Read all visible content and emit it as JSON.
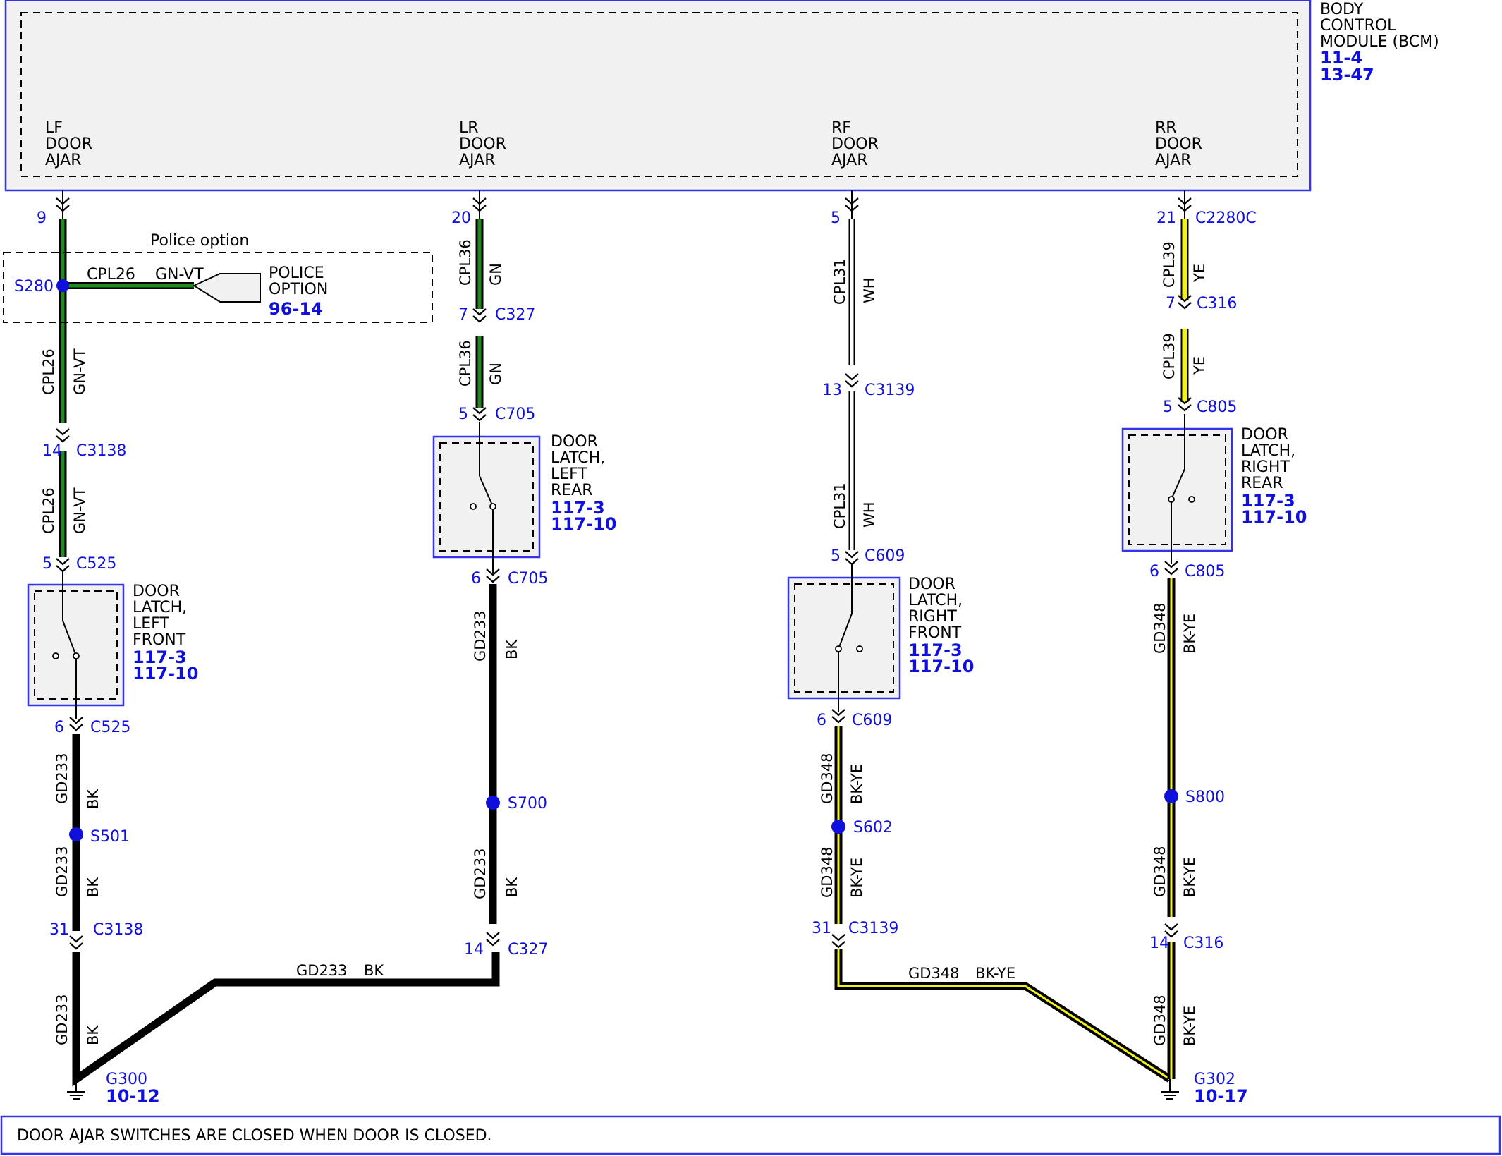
{
  "module": {
    "name_lines": [
      "BODY",
      "CONTROL",
      "MODULE (BCM)"
    ],
    "refs": [
      "11-4",
      "13-47"
    ],
    "pin_lines": [
      [
        "LF",
        "DOOR",
        "AJAR"
      ],
      [
        "LR",
        "DOOR",
        "AJAR"
      ],
      [
        "RF",
        "DOOR",
        "AJAR"
      ],
      [
        "RR",
        "DOOR",
        "AJAR"
      ]
    ]
  },
  "police_option": {
    "title": "Police option",
    "label_lines": [
      "POLICE",
      "OPTION"
    ],
    "ref": "96-14",
    "splice": "S280",
    "wire_circuit": "CPL26",
    "wire_color": "GN-VT"
  },
  "pins": [
    {
      "num": "9"
    },
    {
      "num": "14",
      "conn": "C3138"
    },
    {
      "num": "5",
      "conn": "C525"
    },
    {
      "num": "6",
      "conn": "C525"
    },
    {
      "num": "31",
      "conn": "C3138"
    },
    {
      "num": "20"
    },
    {
      "num": "7",
      "conn": "C327"
    },
    {
      "num": "5",
      "conn": "C705"
    },
    {
      "num": "6",
      "conn": "C705"
    },
    {
      "num": "14",
      "conn": "C327"
    },
    {
      "num": "5"
    },
    {
      "num": "13",
      "conn": "C3139"
    },
    {
      "num": "5",
      "conn": "C609"
    },
    {
      "num": "6",
      "conn": "C609"
    },
    {
      "num": "31",
      "conn": "C3139"
    },
    {
      "num": "21",
      "conn": "C2280C"
    },
    {
      "num": "7",
      "conn": "C316"
    },
    {
      "num": "5",
      "conn": "C805"
    },
    {
      "num": "6",
      "conn": "C805"
    },
    {
      "num": "14",
      "conn": "C316"
    }
  ],
  "splices": [
    "S501",
    "S700",
    "S602",
    "S800"
  ],
  "wire_labels": [
    {
      "circuit": "CPL26",
      "color": "GN-VT"
    },
    {
      "circuit": "CPL26",
      "color": "GN-VT"
    },
    {
      "circuit": "GD233",
      "color": "BK"
    },
    {
      "circuit": "GD233",
      "color": "BK"
    },
    {
      "circuit": "GD233",
      "color": "BK"
    },
    {
      "circuit": "CPL36",
      "color": "GN"
    },
    {
      "circuit": "CPL36",
      "color": "GN"
    },
    {
      "circuit": "GD233",
      "color": "BK"
    },
    {
      "circuit": "GD233",
      "color": "BK"
    },
    {
      "circuit": "CPL31",
      "color": "WH"
    },
    {
      "circuit": "CPL31",
      "color": "WH"
    },
    {
      "circuit": "GD348",
      "color": "BK-YE"
    },
    {
      "circuit": "GD348",
      "color": "BK-YE"
    },
    {
      "circuit": "CPL39",
      "color": "YE"
    },
    {
      "circuit": "CPL39",
      "color": "YE"
    },
    {
      "circuit": "GD348",
      "color": "BK-YE"
    },
    {
      "circuit": "GD348",
      "color": "BK-YE"
    },
    {
      "circuit": "GD348",
      "color": "BK-YE"
    }
  ],
  "horizontal_wires": [
    {
      "circuit": "GD233",
      "color": "BK"
    },
    {
      "circuit": "GD348",
      "color": "BK-YE"
    }
  ],
  "latches": [
    {
      "lines": [
        "DOOR",
        "LATCH,",
        "LEFT",
        "FRONT"
      ],
      "refs": [
        "117-3",
        "117-10"
      ]
    },
    {
      "lines": [
        "DOOR",
        "LATCH,",
        "LEFT",
        "REAR"
      ],
      "refs": [
        "117-3",
        "117-10"
      ]
    },
    {
      "lines": [
        "DOOR",
        "LATCH,",
        "RIGHT",
        "FRONT"
      ],
      "refs": [
        "117-3",
        "117-10"
      ]
    },
    {
      "lines": [
        "DOOR",
        "LATCH,",
        "RIGHT",
        "REAR"
      ],
      "refs": [
        "117-3",
        "117-10"
      ]
    }
  ],
  "grounds": [
    {
      "name": "G300",
      "ref": "10-12"
    },
    {
      "name": "G302",
      "ref": "10-17"
    }
  ],
  "note": "DOOR AJAR SWITCHES ARE CLOSED WHEN DOOR IS CLOSED.",
  "colors": {
    "green": "#1f8a1f",
    "yellow": "#f2f21a",
    "black": "#000000",
    "white": "#ffffff",
    "link_blue": "#1010dd",
    "module_fill": "#f1f1f1",
    "module_border": "#3333ee"
  }
}
